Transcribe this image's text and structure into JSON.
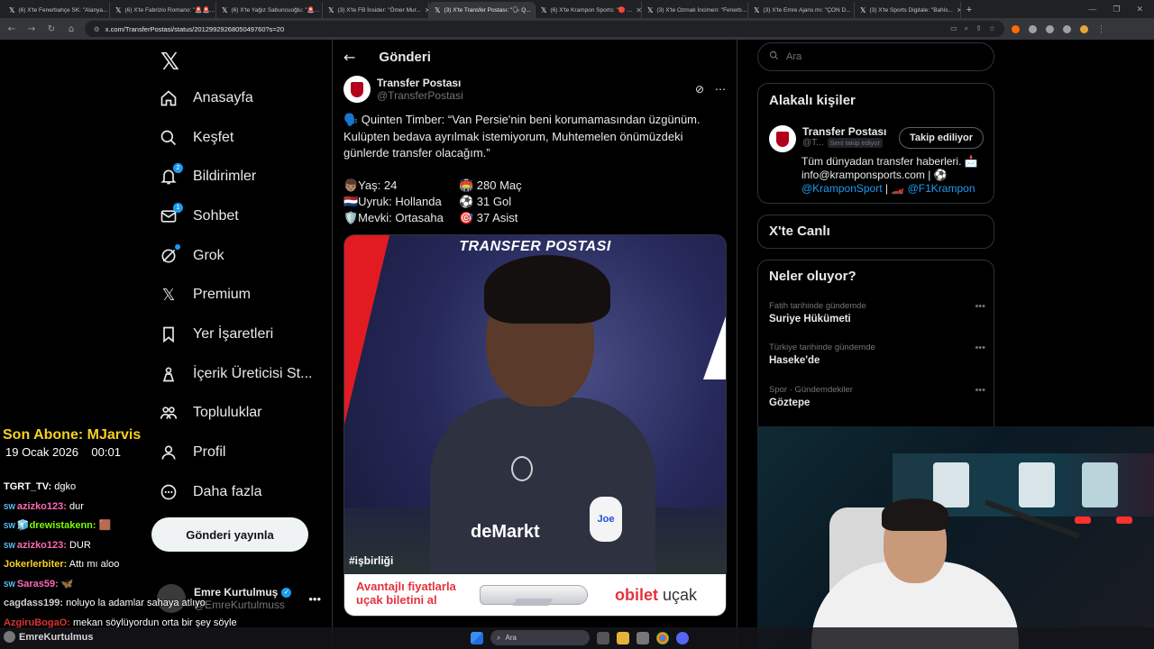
{
  "browser": {
    "tabs": [
      {
        "title": "(6) X'te Fenerbahçe SK: \"Alanya..."
      },
      {
        "title": "(6) X'te Fabrizio Romano: \"🚨🚨..."
      },
      {
        "title": "(6) X'te Yağız Sabuncuoğlu: \"🚨..."
      },
      {
        "title": "(3) X'te FB İnsider: \"Ömer Mur..."
      },
      {
        "title": "(3) X'te Transfer Postası: \"🗣 Q..."
      },
      {
        "title": "(6) X'te Krampon Sports: \"🔴 ..."
      },
      {
        "title": "(3) X'te Ozmak İncimen: \"Fenerb..."
      },
      {
        "title": "(3) X'te Emre Ajans mı: \"ÇON D..."
      },
      {
        "title": "(3) X'te Sports Digitale: \"Bahis..."
      }
    ],
    "active_tab": 4,
    "url": "x.com/TransferPostasi/status/2012992926805049760?s=20"
  },
  "nav": {
    "items": [
      {
        "label": "Anasayfa",
        "icon": "home-icon"
      },
      {
        "label": "Keşfet",
        "icon": "search-icon"
      },
      {
        "label": "Bildirimler",
        "icon": "bell-icon",
        "badge": "2"
      },
      {
        "label": "Sohbet",
        "icon": "mail-icon",
        "badge": "1"
      },
      {
        "label": "Grok",
        "icon": "grok-icon"
      },
      {
        "label": "Premium",
        "icon": "x-premium-icon"
      },
      {
        "label": "Yer İşaretleri",
        "icon": "bookmark-icon"
      },
      {
        "label": "İçerik Üreticisi St...",
        "icon": "creator-studio-icon"
      },
      {
        "label": "Topluluklar",
        "icon": "communities-icon"
      },
      {
        "label": "Profil",
        "icon": "profile-icon"
      },
      {
        "label": "Daha fazla",
        "icon": "more-circle-icon"
      }
    ],
    "post_button": "Gönderi yayınla",
    "account": {
      "name": "Emre Kurtulmuş",
      "handle": "@EmreKurtulmuss"
    }
  },
  "main": {
    "header_title": "Gönderi",
    "author_name": "Transfer Postası",
    "author_handle": "@TransferPostasi",
    "post_text": "🗣️ Quinten Timber: “Van Persie'nin beni korumamasından üzgünüm. Kulüpten bedava ayrılmak istemiyorum, Muhtemelen önümüzdeki günlerde transfer olacağım.”",
    "stats": [
      "👦🏽Yaş: 24",
      "🏟️ 280 Maç",
      "🇳🇱Uyruk: Hollanda",
      "⚽ 31 Gol",
      "🛡️Mevki: Ortasaha",
      "🎯 37 Asist"
    ],
    "media": {
      "banner_title": "TRANSFER POSTASI",
      "hashtag": "#işbirliği",
      "sponsor": "deMarkt",
      "patch": "Joe",
      "ad_line1": "Avantajlı fiyatlarla",
      "ad_line2": "uçak biletini al",
      "ad_brand": "obilet",
      "ad_brand_sub": "uçak"
    }
  },
  "right": {
    "search_placeholder": "Ara",
    "related_title": "Alakalı kişiler",
    "related": {
      "name": "Transfer Postası",
      "handle": "@T...",
      "follows_you": "Seni takip ediyor",
      "follow_button": "Takip ediliyor",
      "bio_text": "Tüm dünyadan transfer haberleri. 📩 info@kramponsports.com | ⚽",
      "bio_link1": "@KramponSport",
      "bio_mid": " | 🏎️ ",
      "bio_link2": "@F1Krampon"
    },
    "live_title": "X'te Canlı",
    "trends_title": "Neler oluyor?",
    "trends": [
      {
        "context": "Fatih tarihinde gündemde",
        "title": "Suriye Hükümeti"
      },
      {
        "context": "Türkiye tarihinde gündemde",
        "title": "Haseke'de"
      },
      {
        "context": "Spor · Gündemdekiler",
        "title": "Göztepe"
      }
    ]
  },
  "overlay": {
    "last_sub": "Son Abone: MJarvis",
    "date": "19 Ocak 2026",
    "time": "00:01",
    "chat": [
      {
        "badge": "",
        "user": "TGRT_TV:",
        "msg": " dgko",
        "color": "#ffffff"
      },
      {
        "badge": "SW",
        "user": "azizko123:",
        "msg": " dur",
        "color": "#ff69b4"
      },
      {
        "badge": "SW",
        "user": "🧊drewistakenn:",
        "msg": " 🟫",
        "color": "#7cfc00"
      },
      {
        "badge": "SW",
        "user": "azizko123:",
        "msg": " DUR",
        "color": "#ff69b4"
      },
      {
        "badge": "",
        "user": "Jokerlerbiter:",
        "msg": " Attı mı aloo",
        "color": "#f5d020"
      },
      {
        "badge": "SW",
        "user": "Saras59:",
        "msg": " 🦋",
        "color": "#ff69b4"
      },
      {
        "badge": "",
        "user": "cagdass199:",
        "msg": " noluyo la adamlar sahaya atlıyo",
        "color": "#d0d0d0"
      },
      {
        "badge": "",
        "user": "AzgiruBogaO:",
        "msg": " mekan söylüyordun orta bir şey söyle",
        "color": "#e03030"
      }
    ]
  },
  "taskbar": {
    "user": "EmreKurtulmus",
    "search_placeholder": "Ara"
  },
  "colors": {
    "accent": "#1d9bf0",
    "background": "#000000",
    "border": "#2f3336",
    "brand_red": "#e21b23"
  }
}
